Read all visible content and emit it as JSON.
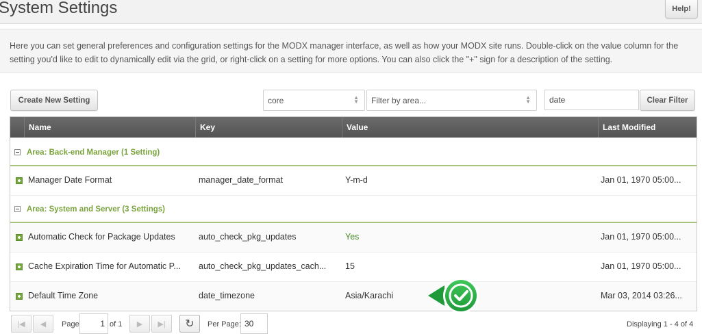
{
  "header": {
    "title": "System Settings",
    "help_label": "Help!"
  },
  "intro": {
    "text": "Here you can set general preferences and configuration settings for the MODX manager interface, as well as how your MODX site runs. Double-click on the value column for the setting you'd like to edit to dynamically edit via the grid, or right-click on a setting for more options. You can also click the \"+\" sign for a description of the setting."
  },
  "toolbar": {
    "create_label": "Create New Setting",
    "namespace_value": "core",
    "area_placeholder": "Filter by area...",
    "search_value": "date",
    "clear_label": "Clear Filter"
  },
  "grid": {
    "columns": [
      "Name",
      "Key",
      "Value",
      "Last Modified"
    ],
    "groups": [
      {
        "label": "Area: Back-end Manager (1 Setting)",
        "rows": [
          {
            "name": "Manager Date Format",
            "key": "manager_date_format",
            "value": "Y-m-d",
            "modified": "Jan 01, 1970 05:00..."
          }
        ]
      },
      {
        "label": "Area: System and Server (3 Settings)",
        "rows": [
          {
            "name": "Automatic Check for Package Updates",
            "key": "auto_check_pkg_updates",
            "value": "Yes",
            "modified": "Jan 01, 1970 05:00..."
          },
          {
            "name": "Cache Expiration Time for Automatic P...",
            "key": "auto_check_pkg_updates_cach...",
            "value": "15",
            "modified": "Jan 01, 1970 05:00..."
          },
          {
            "name": "Default Time Zone",
            "key": "date_timezone",
            "value": "Asia/Karachi",
            "modified": "Mar 03, 2014 03:26..."
          }
        ]
      }
    ]
  },
  "pager": {
    "page_label": "Page",
    "page_value": "1",
    "of_label": "of 1",
    "per_page_label": "Per Page:",
    "per_page_value": "30",
    "displaying": "Displaying 1 - 4 of 4"
  },
  "colors": {
    "group_text": "#7aa33e",
    "header_bg": "#5e5e5e",
    "callout_green": "#2fb24a"
  }
}
